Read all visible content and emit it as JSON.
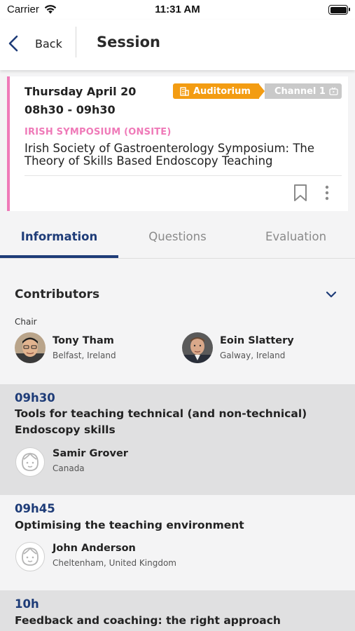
{
  "status_bar": {
    "carrier": "Carrier",
    "time": "11:31 AM"
  },
  "nav": {
    "back_label": "Back",
    "title": "Session"
  },
  "session": {
    "date": "Thursday April 20",
    "time_range": "08h30 - 09h30",
    "room": "Auditorium",
    "channel": "Channel 1",
    "category": "IRISH SYMPOSIUM (ONSITE)",
    "title": "Irish Society of Gastroenterology Symposium: The Theory of Skills Based Endoscopy Teaching",
    "accent_color": "#ef7ab8",
    "room_color": "#f39c12"
  },
  "tabs": [
    {
      "label": "Information",
      "active": true
    },
    {
      "label": "Questions",
      "active": false
    },
    {
      "label": "Evaluation",
      "active": false
    }
  ],
  "contributors": {
    "title": "Contributors",
    "role": "Chair",
    "people": [
      {
        "name": "Tony Tham",
        "location": "Belfast, Ireland",
        "avatar": "photo"
      },
      {
        "name": "Eoin Slattery",
        "location": "Galway, Ireland",
        "avatar": "photo"
      }
    ]
  },
  "talks": [
    {
      "time": "09h30",
      "title": "Tools for teaching technical (and non-technical) Endoscopy skills",
      "speaker": "Samir Grover",
      "location": "Canada"
    },
    {
      "time": "09h45",
      "title": "Optimising the teaching environment",
      "speaker": "John Anderson",
      "location": "Cheltenham, United Kingdom"
    },
    {
      "time": "10h",
      "title": "Feedback and coaching: the right approach"
    }
  ],
  "colors": {
    "primary": "#1e3c78"
  }
}
